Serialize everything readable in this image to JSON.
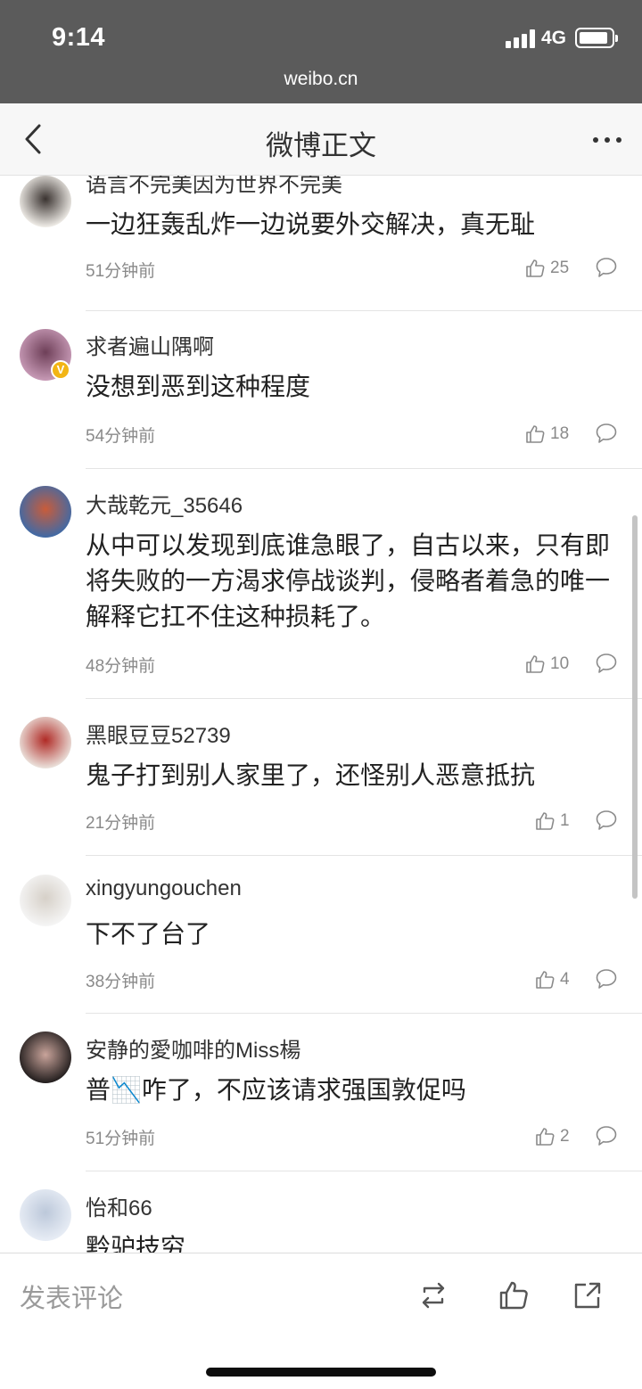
{
  "status_bar": {
    "time": "9:14",
    "network": "4G",
    "url": "weibo.cn"
  },
  "navbar": {
    "title": "微博正文",
    "back_icon": "chevron-left-icon",
    "more_icon": "more-dots-icon"
  },
  "comments": [
    {
      "user": "语言不完美因为世界不完美",
      "text": "一边狂轰乱炸一边说要外交解决，真无耻",
      "time": "51分钟前",
      "likes": "25",
      "verified": false,
      "avatar_colors": [
        "#f4f1ec",
        "#3a3330"
      ]
    },
    {
      "user": "求者遍山隅啊",
      "text": "没想到恶到这种程度",
      "time": "54分钟前",
      "likes": "18",
      "verified": true,
      "avatar_colors": [
        "#c99cb8",
        "#6e3f58"
      ]
    },
    {
      "user": "大哉乾元_35646",
      "text": "从中可以发现到底谁急眼了，自古以来，只有即将失败的一方渴求停战谈判，侵略者着急的唯一解释它扛不住这种损耗了。",
      "time": "48分钟前",
      "likes": "10",
      "verified": false,
      "avatar_colors": [
        "#3d6aa8",
        "#c95c3a"
      ]
    },
    {
      "user": "黑眼豆豆52739",
      "text": "鬼子打到别人家里了，还怪别人恶意抵抗",
      "time": "21分钟前",
      "likes": "1",
      "verified": false,
      "avatar_colors": [
        "#ece6e0",
        "#b02b26"
      ]
    },
    {
      "user": "xingyungouchen",
      "text": "下不了台了",
      "time": "38分钟前",
      "likes": "4",
      "verified": false,
      "avatar_colors": [
        "#f6f6f6",
        "#d6d0c8"
      ]
    },
    {
      "user": "安静的愛咖啡的Miss楊",
      "text_before": "普",
      "emoji": "📉",
      "text_after": "咋了，不应该请求强国敦促吗",
      "time": "51分钟前",
      "likes": "2",
      "verified": false,
      "avatar_colors": [
        "#1f1b1b",
        "#c9a49b"
      ]
    },
    {
      "user": "怡和66",
      "text": "黔驴技穷",
      "time": "",
      "likes": "",
      "verified": false,
      "avatar_colors": [
        "#e9eef6",
        "#bcc8da"
      ]
    }
  ],
  "bottom_bar": {
    "placeholder": "发表评论",
    "icons": [
      "repost-icon",
      "like-icon",
      "share-icon"
    ]
  },
  "colors": {
    "status_bar_bg": "#5b5b5b",
    "nav_bg": "#f7f7f7",
    "meta_gray": "#8a8a8a",
    "verified_badge": "#f2b515"
  }
}
